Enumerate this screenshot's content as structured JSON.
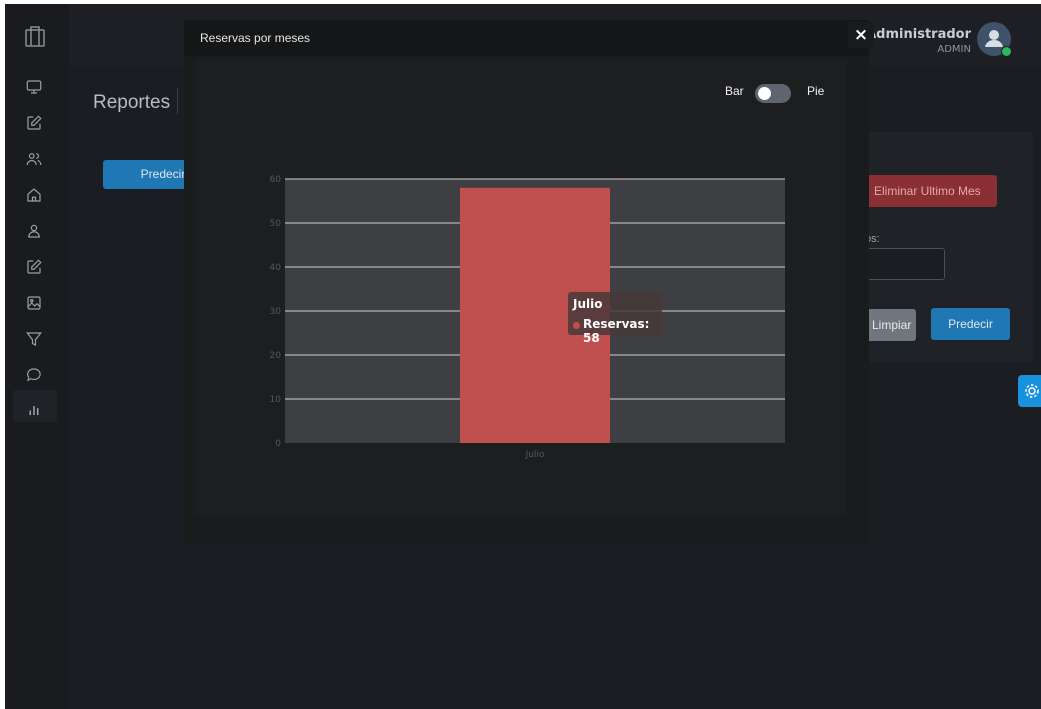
{
  "app": {
    "user": {
      "name": "Administrador",
      "role": "ADMIN"
    },
    "page_title": "Reportes"
  },
  "sidebar": {
    "items": [
      {
        "icon": "monitor-icon"
      },
      {
        "icon": "edit-icon"
      },
      {
        "icon": "users-icon"
      },
      {
        "icon": "home-icon"
      },
      {
        "icon": "user-icon"
      },
      {
        "icon": "edit-icon"
      },
      {
        "icon": "image-icon"
      },
      {
        "icon": "filter-icon"
      },
      {
        "icon": "chat-icon"
      },
      {
        "icon": "bar-chart-icon"
      }
    ]
  },
  "background": {
    "predecir_left_label": "Predecir",
    "eliminar_label": "Eliminar Ultimo Mes",
    "meses_label": "os:",
    "limpiar_label": "Limpiar",
    "predecir_right_label": "Predecir"
  },
  "modal": {
    "title": "Reservas por meses",
    "close_label": "×",
    "toggle": {
      "left_label": "Bar",
      "right_label": "Pie",
      "state": "Bar"
    }
  },
  "tooltip": {
    "title": "Julio",
    "body": "Reservas: 58"
  },
  "colors": {
    "accent": "#1f77b4",
    "danger": "#8a2f33",
    "bar": "#c0504d",
    "plot_bg": "#3e3f42"
  },
  "chart_data": {
    "type": "bar",
    "categories": [
      "Julio"
    ],
    "series": [
      {
        "name": "Reservas",
        "values": [
          58
        ]
      }
    ],
    "ylim": [
      0,
      60
    ],
    "yticks": [
      0,
      10,
      20,
      30,
      40,
      50,
      60
    ],
    "grid": true,
    "title": "",
    "xlabel": "",
    "ylabel": ""
  }
}
